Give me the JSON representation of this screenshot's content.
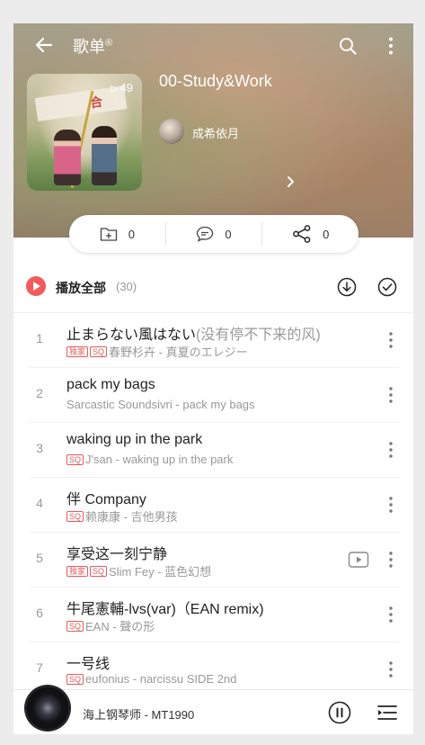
{
  "header": {
    "page_title": "歌单",
    "page_title_mark": "®",
    "playlist_name": "00-Study&Work",
    "play_count": "49",
    "creator_name": "成希依月"
  },
  "actions": {
    "add_count": "0",
    "comment_count": "0",
    "share_count": "0"
  },
  "play_all": {
    "label": "播放全部",
    "count": "(30)"
  },
  "songs": [
    {
      "index": "1",
      "title": "止まらない風はない",
      "alias": "(没有停不下来的风)",
      "tags": [
        "独家",
        "SQ"
      ],
      "artist_album": "春野杉卉 - 真夏のエレジー",
      "has_mv": false
    },
    {
      "index": "2",
      "title": "pack my bags",
      "alias": "",
      "tags": [],
      "artist_album": "Sarcastic Soundsivri - pack my bags",
      "has_mv": false
    },
    {
      "index": "3",
      "title": "waking up in the park",
      "alias": "",
      "tags": [
        "SQ"
      ],
      "artist_album": "J'san - waking up in the park",
      "has_mv": false
    },
    {
      "index": "4",
      "title": "伴 Company",
      "alias": "",
      "tags": [
        "SQ"
      ],
      "artist_album": "赖康康 - 吉他男孩",
      "has_mv": false
    },
    {
      "index": "5",
      "title": "享受这一刻宁静",
      "alias": "",
      "tags": [
        "独家",
        "SQ"
      ],
      "artist_album": "Slim Fey - 蓝色幻想",
      "has_mv": true
    },
    {
      "index": "6",
      "title": "牛尾憲輔-lvs(var)（EAN remix)",
      "alias": "",
      "tags": [
        "SQ"
      ],
      "artist_album": "EAN - 聲の形",
      "has_mv": false
    },
    {
      "index": "7",
      "title": "一号线",
      "alias": "",
      "tags": [
        "SQ"
      ],
      "artist_album": "eufonius - narcissu SIDE 2nd",
      "has_mv": false
    }
  ],
  "player": {
    "now_playing": "海上钢琴师 - MT1990"
  }
}
